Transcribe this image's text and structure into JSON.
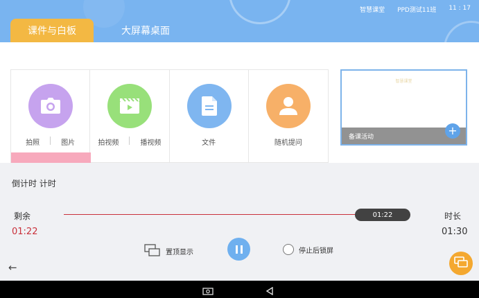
{
  "header": {
    "status": {
      "app": "智慧课堂",
      "class_name": "PPD测试11班",
      "time": "11 : 17"
    },
    "tabs": [
      {
        "label": "课件与白板",
        "active": true
      },
      {
        "label": "大屏幕桌面",
        "active": false
      }
    ]
  },
  "cards": [
    {
      "icon": "camera-icon",
      "color": "#c6a3ee",
      "labels": [
        "拍照",
        "图片"
      ]
    },
    {
      "icon": "video-icon",
      "color": "#98e07a",
      "labels": [
        "拍视频",
        "播视频"
      ]
    },
    {
      "icon": "document-icon",
      "color": "#7fb6f0",
      "labels": [
        "文件"
      ]
    },
    {
      "icon": "person-icon",
      "color": "#f7b068",
      "labels": [
        "随机提问"
      ]
    }
  ],
  "prep": {
    "watermark": "智慧课堂",
    "label": "备课活动",
    "add_icon": "plus-icon"
  },
  "timer": {
    "title": "倒计时 计时",
    "remaining_label": "剩余",
    "remaining_value": "01:22",
    "duration_label": "时长",
    "duration_value": "01:30",
    "thumb_value": "01:22",
    "progress_fraction": 0.91,
    "pin_label": "置顶显示",
    "lock_label": "停止后锁屏"
  },
  "colors": {
    "header": "#79b4f0",
    "tab_active": "#f3b843",
    "accent_red": "#c9303a",
    "pause": "#6fb0ef",
    "float": "#f4a830"
  }
}
